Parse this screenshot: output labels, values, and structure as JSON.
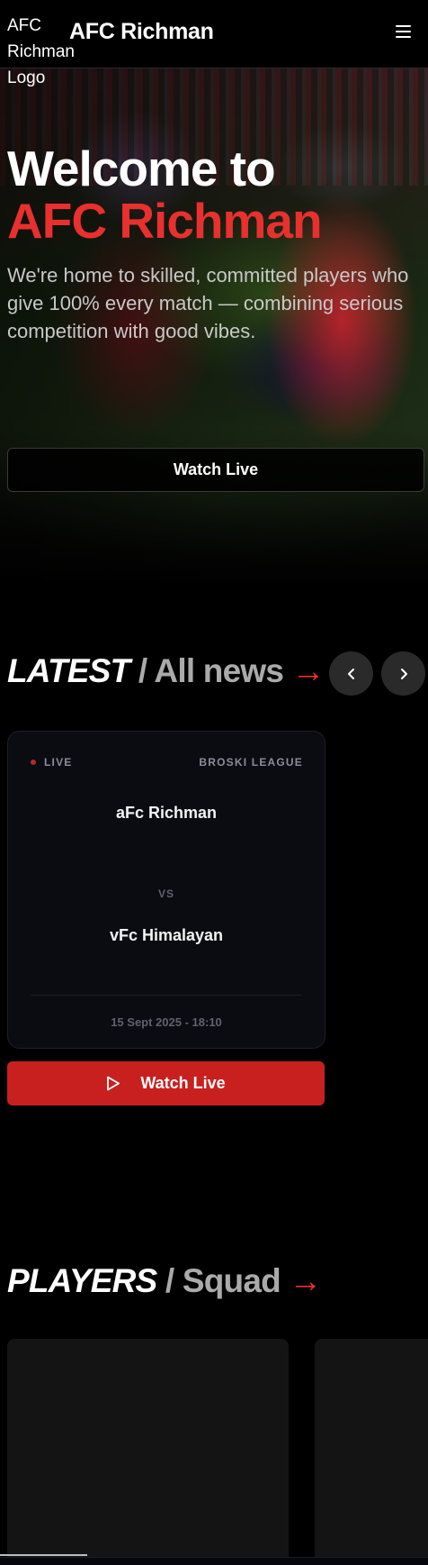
{
  "header": {
    "logo_alt": "AFC Richman Logo",
    "brand": "AFC Richman",
    "menu_icon": "hamburger-menu-icon"
  },
  "hero": {
    "title_line1": "Welcome to",
    "title_line2": "AFC Richman",
    "description": "We're home to skilled, committed players who give 100% every match — combining serious competition with good vibes.",
    "button_label": "Watch Live",
    "accent_color": "#e8302e"
  },
  "latest": {
    "title": "LATEST",
    "subtitle": "/ All news",
    "arrow": "→",
    "prev_icon": "chevron-left-icon",
    "next_icon": "chevron-right-icon",
    "match": {
      "status": "LIVE",
      "league": "BROSKI LEAGUE",
      "home_team": "aFc Richman",
      "vs": "VS",
      "away_team": "vFc Himalayan",
      "datetime": "15 Sept 2025 - 18:10"
    },
    "watch_button": {
      "label": "Watch Live",
      "icon": "play-icon",
      "color": "#c8201f"
    }
  },
  "players": {
    "title": "PLAYERS",
    "subtitle": "/ Squad",
    "arrow": "→"
  }
}
